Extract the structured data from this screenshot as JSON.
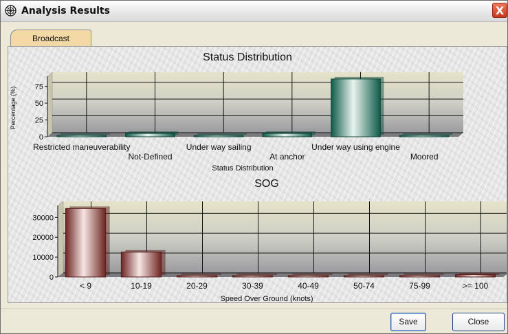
{
  "window": {
    "title": "Analysis Results",
    "close_glyph": "X",
    "icon": "compass-icon"
  },
  "tabs": [
    {
      "label": "Broadcast",
      "active": true
    }
  ],
  "buttons": {
    "save": "Save",
    "close": "Close"
  },
  "chart_data": [
    {
      "type": "bar",
      "title": "Status Distribution",
      "xlabel": "Status Distribution",
      "ylabel": "Percentage (%)",
      "ylim": [
        0,
        90
      ],
      "yticks": [
        "0",
        "25",
        "50",
        "75"
      ],
      "categories": [
        "Restricted maneuverability",
        "Not-Defined",
        "Under way sailing",
        "At anchor",
        "Under way using engine",
        "Moored"
      ],
      "values": [
        1,
        5,
        2,
        5,
        86,
        1
      ],
      "color": "#1f7a66",
      "grid": true
    },
    {
      "type": "bar",
      "title": "SOG",
      "xlabel": "Speed Over Ground (knots)",
      "ylabel": "",
      "ylim": [
        0,
        36000
      ],
      "yticks": [
        "0",
        "10000",
        "20000",
        "30000"
      ],
      "categories": [
        "< 9",
        "10-19",
        "20-29",
        "30-39",
        "40-49",
        "50-74",
        "75-99",
        ">= 100"
      ],
      "values": [
        34500,
        12500,
        300,
        200,
        150,
        700,
        200,
        1200
      ],
      "color": "#8a3a36",
      "grid": true
    }
  ]
}
